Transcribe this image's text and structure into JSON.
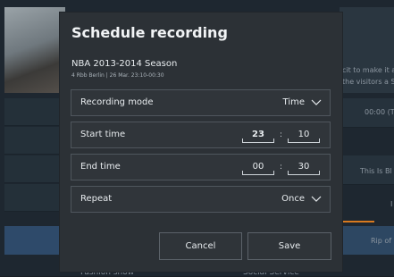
{
  "background": {
    "right_text_1": "cit to make it a",
    "right_text_2": "the visitors a S",
    "right_time": "00:00 (T",
    "right_row_text": "This Is Bl",
    "right_row_text2": "Rip of",
    "right_letter": "I",
    "bottom_left": "Fashion show",
    "bottom_right": "Social Service"
  },
  "dialog": {
    "title": "Schedule recording",
    "program_title": "NBA 2013-2014 Season",
    "program_subtitle": "4 Rbb Berlin | 26 Mar. 23:10-00:30",
    "recording_mode": {
      "label": "Recording mode",
      "value": "Time"
    },
    "start_time": {
      "label": "Start time",
      "hour": "23",
      "minute": "10",
      "separator": ":"
    },
    "end_time": {
      "label": "End time",
      "hour": "00",
      "minute": "30",
      "separator": ":"
    },
    "repeat": {
      "label": "Repeat",
      "value": "Once"
    },
    "cancel_label": "Cancel",
    "save_label": "Save"
  },
  "colors": {
    "dialog_bg": "#2c3136",
    "accent": "#d97a1f"
  }
}
